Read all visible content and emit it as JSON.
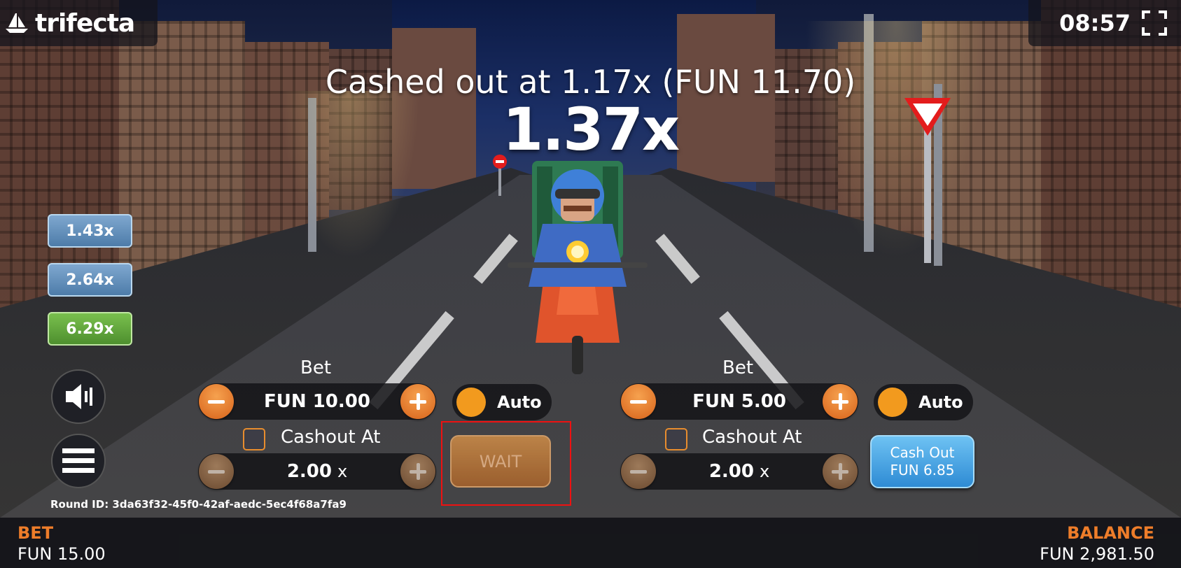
{
  "brand": {
    "logo_text": "trifecta"
  },
  "clock": {
    "time": "08:57"
  },
  "round": {
    "cashed_out_text": "Cashed out at 1.17x (FUN 11.70)",
    "current_multiplier": "1.37x",
    "round_id": "Round ID: 3da63f32-45f0-42af-aedc-5ec4f68a7fa9"
  },
  "history": [
    {
      "value": "1.43x",
      "color": "blue"
    },
    {
      "value": "2.64x",
      "color": "blue"
    },
    {
      "value": "6.29x",
      "color": "green"
    }
  ],
  "panels": [
    {
      "bet_label": "Bet",
      "bet_value": "FUN 10.00",
      "auto_label": "Auto",
      "cashout_label": "Cashout At",
      "cashout_value": "2.00",
      "cashout_unit": "x",
      "action_label": "WAIT"
    },
    {
      "bet_label": "Bet",
      "bet_value": "FUN 5.00",
      "auto_label": "Auto",
      "cashout_label": "Cashout At",
      "cashout_value": "2.00",
      "cashout_unit": "x",
      "action_line1": "Cash Out",
      "action_line2": "FUN 6.85"
    }
  ],
  "footer": {
    "bet_title": "BET",
    "bet_value": "FUN 15.00",
    "balance_title": "BALANCE",
    "balance_value": "FUN 2,981.50"
  },
  "colors": {
    "accent_orange": "#ee7d2a",
    "cashout_blue": "#2e8bd4",
    "history_blue": "#4d7ca9",
    "history_green": "#4e8f2e",
    "wait_highlight": "#e11111"
  },
  "icons": [
    "boat-logo-icon",
    "fullscreen-icon",
    "speaker-icon",
    "hamburger-menu-icon",
    "minus-icon",
    "plus-icon"
  ]
}
